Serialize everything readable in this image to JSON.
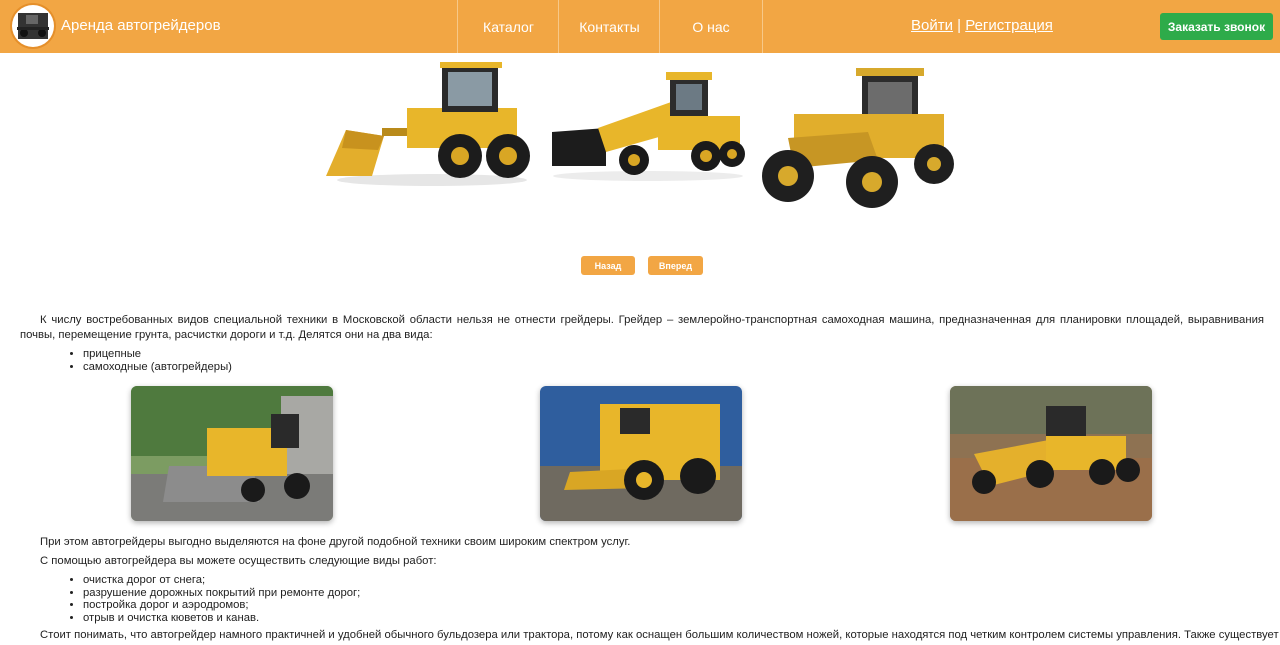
{
  "header": {
    "site_title": "Аренда автогрейдеров",
    "nav": [
      "Каталог",
      "Контакты",
      "О нас"
    ],
    "login": "Войти",
    "separator": "|",
    "register": "Регистрация",
    "call_button": "Заказать звонок"
  },
  "slider": {
    "prev": "Назад",
    "next": "Вперед"
  },
  "content": {
    "intro": "К числу востребованных видов специальной техники в Московской области нельзя не отнести грейдеры. Грейдер – землеройно-транспортная самоходная машина, предназначенная для планировки площадей, выравнивания почвы, перемещение грунта, расчистки дороги и т.д. Делятся они на два вида:",
    "types": [
      "прицепные",
      "самоходные (автогрейдеры)"
    ],
    "para2": "При этом автогрейдеры выгодно выделяются на фоне другой подобной техники своим широким спектром услуг.",
    "para3": "С помощью автогрейдера вы можете осуществить следующие виды работ:",
    "works": [
      "очистка дорог от снега;",
      "разрушение дорожных покрытий при ремонте дорог;",
      "постройка дорог и аэродромов;",
      "отрыв и очистка кюветов и канав."
    ],
    "para4": "Стоит понимать, что автогрейдер намного практичней и удобней обычного бульдозера или трактора, потому как оснащен большим количеством ножей, которые находятся под четким контролем системы управления. Также существует"
  },
  "colors": {
    "header_bg": "#f2a644",
    "call_button_bg": "#2eab4a",
    "machine_yellow": "#e8b62a"
  }
}
